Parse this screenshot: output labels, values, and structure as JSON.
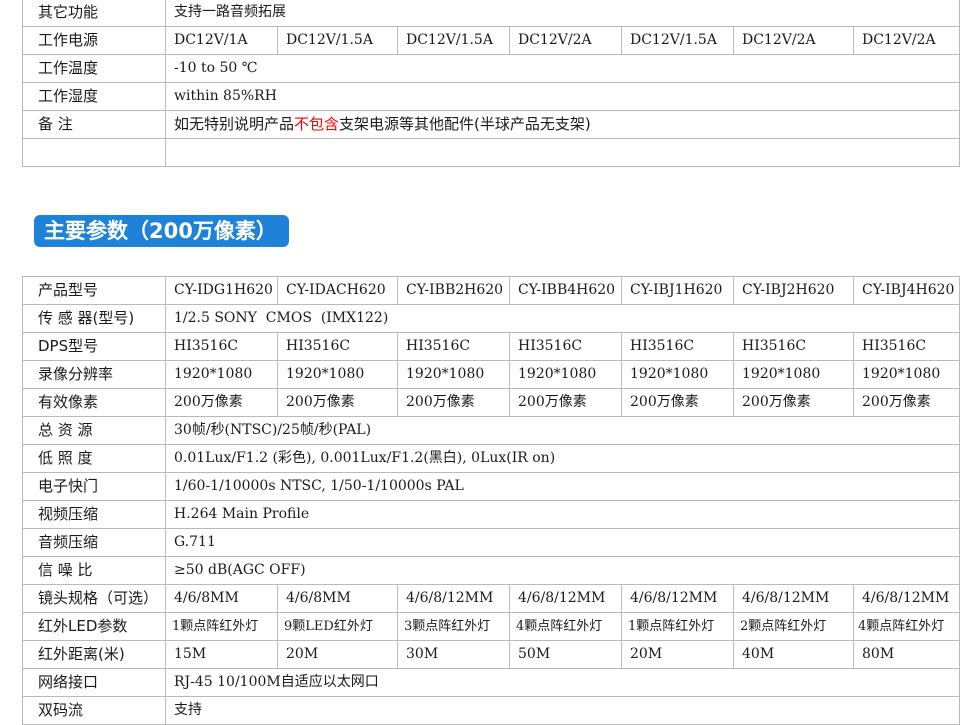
{
  "top_table": {
    "rows": [
      {
        "label": "其它功能",
        "cells": [
          "支持一路音频拓展"
        ]
      },
      {
        "label": "工作电源",
        "cells": [
          "DC12V/1A",
          "DC12V/1.5A",
          "DC12V/1.5A",
          "DC12V/2A",
          "DC12V/1.5A",
          "DC12V/2A",
          "DC12V/2A"
        ]
      },
      {
        "label": "工作温度",
        "cells": [
          "-10 to 50 ℃"
        ]
      },
      {
        "label": "工作湿度",
        "cells": [
          "within 85%RH"
        ]
      },
      {
        "label": "备 注",
        "note_before": "如无特别说明产品",
        "note_red": "不包含",
        "note_after": "支架电源等其他配件(半球产品无支架)"
      },
      {
        "label": "",
        "cells": [
          ""
        ]
      }
    ]
  },
  "section_title": "主要参数（200万像素）",
  "spec_table": {
    "rows": [
      {
        "label": "产品型号",
        "cells": [
          "CY-IDG1H620",
          "CY-IDACH620",
          "CY-IBB2H620",
          "CY-IBB4H620",
          "CY-IBJ1H620",
          "CY-IBJ2H620",
          "CY-IBJ4H620"
        ]
      },
      {
        "label": "传 感 器(型号)",
        "cells": [
          "1/2.5 SONY  CMOS  (IMX122)"
        ]
      },
      {
        "label": "DPS型号",
        "cells": [
          "HI3516C",
          "HI3516C",
          "HI3516C",
          "HI3516C",
          "HI3516C",
          "HI3516C",
          "HI3516C"
        ]
      },
      {
        "label": "录像分辨率",
        "cells": [
          "1920*1080",
          "1920*1080",
          "1920*1080",
          "1920*1080",
          "1920*1080",
          "1920*1080",
          "1920*1080"
        ]
      },
      {
        "label": "有效像素",
        "cells": [
          "200万像素",
          "200万像素",
          "200万像素",
          "200万像素",
          "200万像素",
          "200万像素",
          "200万像素"
        ]
      },
      {
        "label": "总 资 源",
        "cells": [
          "30帧/秒(NTSC)/25帧/秒(PAL)"
        ]
      },
      {
        "label": "低 照 度",
        "cells": [
          "0.01Lux/F1.2 (彩色), 0.001Lux/F1.2(黑白), 0Lux(IR on)"
        ]
      },
      {
        "label": "电子快门",
        "cells": [
          "1/60-1/10000s NTSC, 1/50-1/10000s PAL"
        ]
      },
      {
        "label": "视频压缩",
        "cells": [
          "H.264 Main Profile"
        ]
      },
      {
        "label": "音频压缩",
        "cells": [
          "G.711"
        ]
      },
      {
        "label": "信 噪 比",
        "cells": [
          "≥50 dB(AGC OFF)"
        ]
      },
      {
        "label": "镜头规格（可选）",
        "cells": [
          "4/6/8MM",
          "4/6/8MM",
          "4/6/8/12MM",
          "4/6/8/12MM",
          "4/6/8/12MM",
          "4/6/8/12MM",
          "4/6/8/12MM"
        ]
      },
      {
        "label": "红外LED参数",
        "cells": [
          "1颗点阵红外灯",
          "9颗LED红外灯",
          "3颗点阵红外灯",
          "4颗点阵红外灯",
          "1颗点阵红外灯",
          "2颗点阵红外灯",
          "4颗点阵红外灯"
        ]
      },
      {
        "label": "红外距离(米)",
        "cells": [
          "15M",
          "20M",
          "30M",
          "50M",
          "20M",
          "40M",
          "80M"
        ]
      },
      {
        "label": "网络接口",
        "cells": [
          "RJ-45 10/100M自适应以太网口"
        ]
      },
      {
        "label": "双码流",
        "cells": [
          "支持"
        ]
      }
    ]
  },
  "colors": {
    "accent": "#1e83d8",
    "highlight": "#ff0000",
    "border": "#b9b9b9"
  }
}
